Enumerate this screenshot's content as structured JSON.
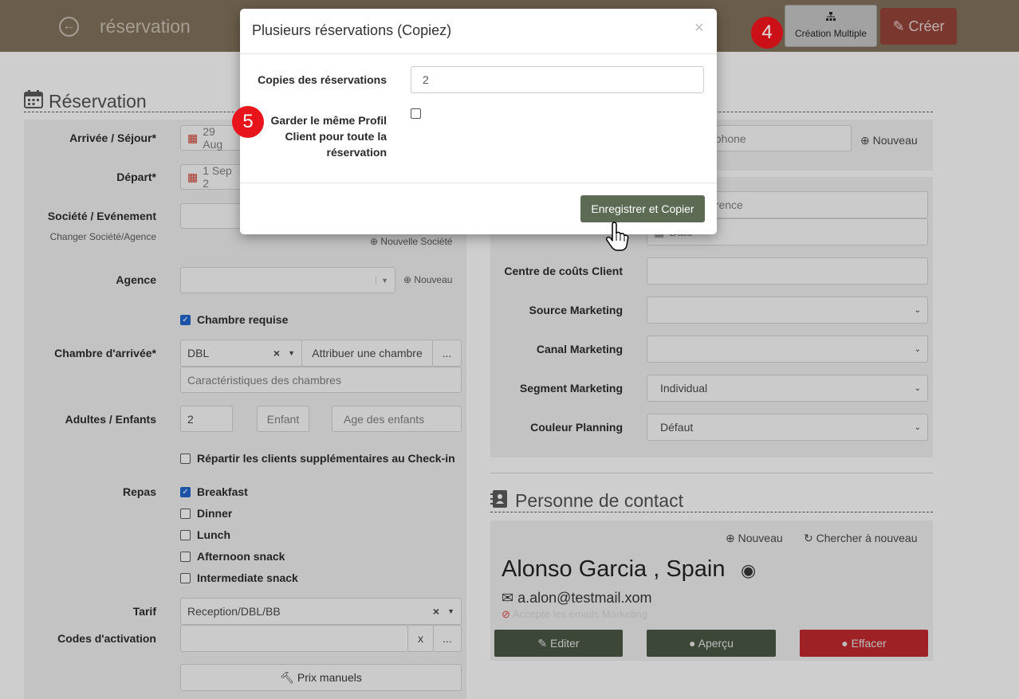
{
  "topbar": {
    "title": "réservation",
    "back_icon": "arrow-left-circle-icon",
    "multi_label": "Création Multiple",
    "create_label": "Créer"
  },
  "steps": {
    "four": "4",
    "five": "5"
  },
  "reservation": {
    "header": "Réservation",
    "arrival_label": "Arrivée / Séjour*",
    "arrival_value": "29 Aug",
    "departure_label": "Départ*",
    "departure_value": "1 Sep 2",
    "company_label": "Société / Evénement",
    "company_sub": "Changer Société/Agence",
    "new_company": "Nouvelle Société",
    "agency_label": "Agence",
    "agency_new": "Nouveau",
    "room_required": "Chambre requise",
    "room_label": "Chambre d'arrivée*",
    "room_value": "DBL",
    "assign_room": "Attribuer une chambre",
    "more": "...",
    "room_features": "Caractéristiques des chambres",
    "adults_label": "Adultes / Enfants",
    "adults_value": "2",
    "children_placeholder": "Enfant",
    "ages_placeholder": "Age des enfants",
    "split_label": "Répartir les clients supplémentaires au Check-in",
    "meals_label": "Repas",
    "meals": [
      {
        "label": "Breakfast",
        "checked": true
      },
      {
        "label": "Dinner",
        "checked": false
      },
      {
        "label": "Lunch",
        "checked": false
      },
      {
        "label": "Afternoon snack",
        "checked": false
      },
      {
        "label": "Intermediate snack",
        "checked": false
      }
    ],
    "rate_label": "Tarif",
    "rate_value": "Reception/DBL/BB",
    "activation_label": "Codes d'activation",
    "clear": "x",
    "manual_prices": "Prix manuels"
  },
  "right": {
    "phone_placeholder": "éphone",
    "new": "Nouveau",
    "ref_placeholder": "érence",
    "date_placeholder": "Date",
    "cost_center": "Centre de coûts Client",
    "source": "Source Marketing",
    "channel": "Canal Marketing",
    "segment": "Segment Marketing",
    "segment_value": "Individual",
    "color": "Couleur Planning",
    "color_value": "Défaut"
  },
  "contact": {
    "header": "Personne de contact",
    "new": "Nouveau",
    "search": "Chercher à nouveau",
    "name": "Alonso Garcia , Spain",
    "email": "a.alon@testmail.xom",
    "marketing": "Accepte les emails Marketing",
    "edit": "Editer",
    "preview": "Aperçu",
    "delete": "Effacer"
  },
  "modal": {
    "title": "Plusieurs réservations (Copiez)",
    "close": "×",
    "copies_label": "Copies des réservations",
    "copies_value": "2",
    "keep_profile_1": "Garder le même Profil",
    "keep_profile_2": "Client pour toute la",
    "keep_profile_3": "réservation",
    "save": "Enregistrer et Copier"
  },
  "colors": {
    "topbar": "#7a6a56",
    "accent_green": "#5c6b53",
    "danger": "#8a3f35",
    "step": "#e8141b"
  }
}
